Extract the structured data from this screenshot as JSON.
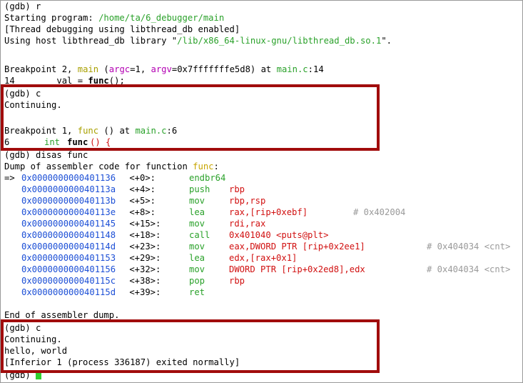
{
  "terminal": {
    "l1": "(gdb) r",
    "l2_label": "Starting program: ",
    "l2_path": "/home/ta/6_debugger/main",
    "l3": "[Thread debugging using libthread_db enabled]",
    "l4_a": "Using host libthread_db library \"",
    "l4_path": "/lib/x86_64-linux-gnu/libthread_db.so.1",
    "l4_b": "\".",
    "bp2": {
      "a": "Breakpoint 2, ",
      "fn": "main",
      "p1": " (",
      "argc": "argc",
      "eq1": "=1, ",
      "argv": "argv",
      "eq2": "=0x7fffffffe5d8) at ",
      "file": "main.c",
      "line": ":14"
    },
    "src14": {
      "num": "14",
      "code1": "        val = ",
      "call": "func",
      "code2": "();"
    },
    "cont1": "(gdb) c",
    "continuing1": "Continuing.",
    "bp1": {
      "a": "Breakpoint 1, ",
      "fn": "func",
      "mid": " () at ",
      "file": "main.c",
      "line": ":6"
    },
    "src6": {
      "num": "6",
      "kw": "int",
      "fn": "func",
      "rest": "() {"
    },
    "disas_cmd": "(gdb) disas func",
    "dump_label": "Dump of assembler code for function ",
    "dump_fn": "func",
    "dump_colon": ":",
    "asm": [
      {
        "arrow": "=> ",
        "addr": "0x0000000000401136",
        "off": " <+0>:",
        "op": "endbr64",
        "arg": "",
        "cmt": ""
      },
      {
        "arrow": "   ",
        "addr": "0x000000000040113a",
        "off": " <+4>:",
        "op": "push",
        "arg": "rbp",
        "cmt": ""
      },
      {
        "arrow": "   ",
        "addr": "0x000000000040113b",
        "off": " <+5>:",
        "op": "mov",
        "arg": "rbp,rsp",
        "cmt": ""
      },
      {
        "arrow": "   ",
        "addr": "0x000000000040113e",
        "off": " <+8>:",
        "op": "lea",
        "arg": "rax,[rip+0xebf]",
        "cmt": "# 0x402004"
      },
      {
        "arrow": "   ",
        "addr": "0x0000000000401145",
        "off": " <+15>:",
        "op": "mov",
        "arg": "rdi,rax",
        "cmt": ""
      },
      {
        "arrow": "   ",
        "addr": "0x0000000000401148",
        "off": " <+18>:",
        "op": "call",
        "arg": "0x401040 <puts@plt>",
        "cmt": ""
      },
      {
        "arrow": "   ",
        "addr": "0x000000000040114d",
        "off": " <+23>:",
        "op": "mov",
        "arg": "eax,DWORD PTR [rip+0x2ee1]",
        "cmt": "# 0x404034 <cnt>"
      },
      {
        "arrow": "   ",
        "addr": "0x0000000000401153",
        "off": " <+29>:",
        "op": "lea",
        "arg": "edx,[rax+0x1]",
        "cmt": ""
      },
      {
        "arrow": "   ",
        "addr": "0x0000000000401156",
        "off": " <+32>:",
        "op": "mov",
        "arg": "DWORD PTR [rip+0x2ed8],edx",
        "cmt": "# 0x404034 <cnt>"
      },
      {
        "arrow": "   ",
        "addr": "0x000000000040115c",
        "off": " <+38>:",
        "op": "pop",
        "arg": "rbp",
        "cmt": ""
      },
      {
        "arrow": "   ",
        "addr": "0x000000000040115d",
        "off": " <+39>:",
        "op": "ret",
        "arg": "",
        "cmt": ""
      }
    ],
    "end_dump": "End of assembler dump.",
    "cont2": "(gdb) c",
    "continuing2": "Continuing.",
    "hello": "hello, world",
    "exited": "[Inferior 1 (process 336187) exited normally]",
    "prompt": "(gdb) "
  },
  "colors": {
    "highlight_box": "#a10c0c",
    "cursor": "#2fd22f"
  }
}
